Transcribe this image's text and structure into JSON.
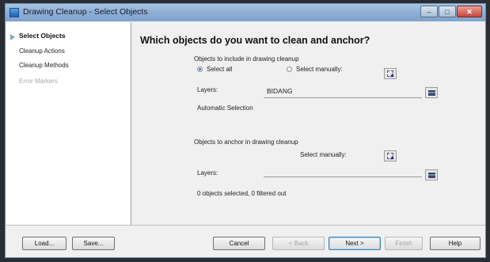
{
  "window": {
    "title": "Drawing Cleanup - Select Objects"
  },
  "window_controls": {
    "minimize": "–",
    "maximize": "□",
    "close": "✕"
  },
  "sidebar": {
    "items": [
      {
        "label": "Select Objects",
        "state": "active"
      },
      {
        "label": "Cleanup Actions",
        "state": "normal"
      },
      {
        "label": "Cleanup Methods",
        "state": "normal"
      },
      {
        "label": "Error Markers",
        "state": "disabled"
      }
    ]
  },
  "main": {
    "heading": "Which objects do you want to clean and anchor?",
    "include_section": {
      "label": "Objects to include in drawing cleanup",
      "select_all_label": "Select all",
      "select_manually_label": "Select manually:",
      "selected_option": "Select all",
      "layers_label": "Layers:",
      "layers_value": "BIDANG",
      "automatic_selection": "Automatic Selection"
    },
    "anchor_section": {
      "label": "Objects to anchor in drawing cleanup",
      "select_manually_label": "Select manually:",
      "layers_label": "Layers:",
      "layers_value": "",
      "status": "0 objects selected, 0 filtered out"
    }
  },
  "footer": {
    "load": "Load...",
    "save": "Save...",
    "cancel": "Cancel",
    "back": "< Back",
    "next": "Next >",
    "finish": "Finish",
    "help": "Help"
  },
  "colors": {
    "title_bar": "#8fb0d6",
    "close_button": "#c8453a",
    "radio_selected": "#2b6cc4",
    "disabled_text": "#a8a8a8"
  }
}
